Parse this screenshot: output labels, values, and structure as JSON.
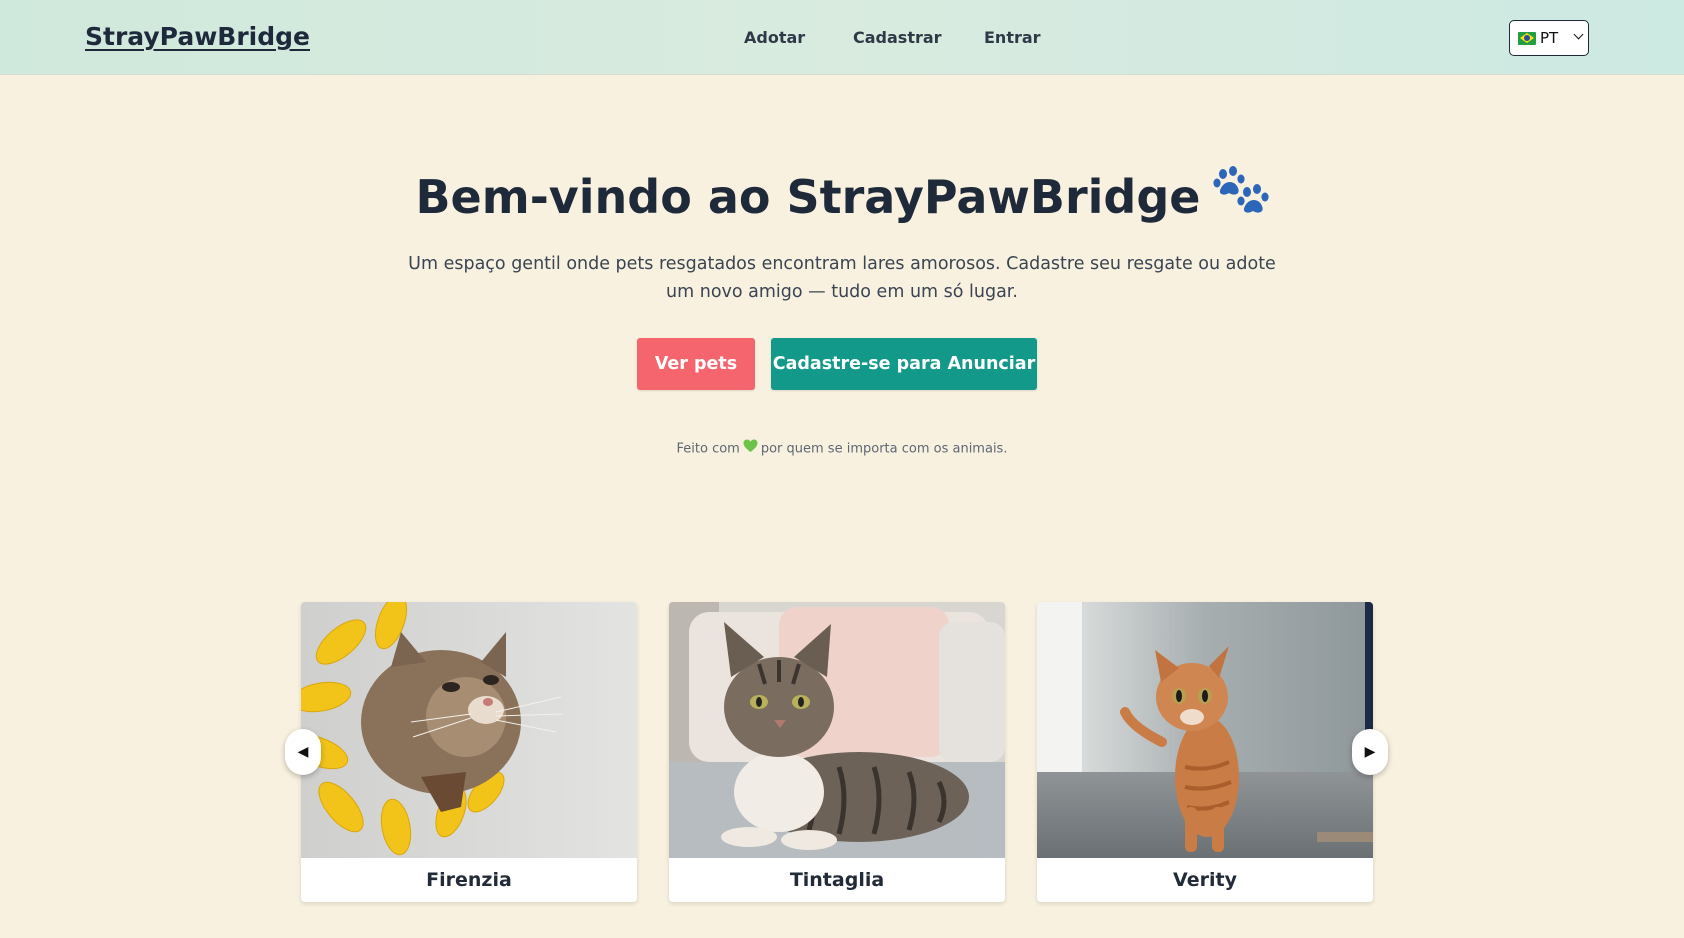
{
  "header": {
    "logo": "StrayPawBridge",
    "nav": [
      {
        "label": "Adotar"
      },
      {
        "label": "Cadastrar"
      },
      {
        "label": "Entrar"
      }
    ],
    "language": {
      "selected": "PT",
      "flag_icon": "brazil-flag-icon"
    }
  },
  "hero": {
    "title": "Bem-vindo ao StrayPawBridge",
    "title_icon": "paw-prints-icon",
    "subtitle": "Um espaço gentil onde pets resgatados encontram lares amorosos. Cadastre seu resgate ou adote um novo amigo — tudo em um só lugar.",
    "primary_button": "Ver pets",
    "secondary_button": "Cadastre-se para Anunciar",
    "made_with_prefix": "Feito com",
    "made_with_suffix": "por quem se importa com os animais.",
    "heart_icon": "green-heart-icon"
  },
  "carousel": {
    "prev_icon": "arrow-left-icon",
    "next_icon": "arrow-right-icon",
    "prev_label": "◀",
    "next_label": "▶",
    "pets": [
      {
        "name": "Firenzia"
      },
      {
        "name": "Tintaglia"
      },
      {
        "name": "Verity"
      }
    ]
  },
  "colors": {
    "background": "#f9f1df",
    "primary_button": "#f4656e",
    "secondary_button": "#12998a",
    "header_bg": "#d6ebde"
  }
}
